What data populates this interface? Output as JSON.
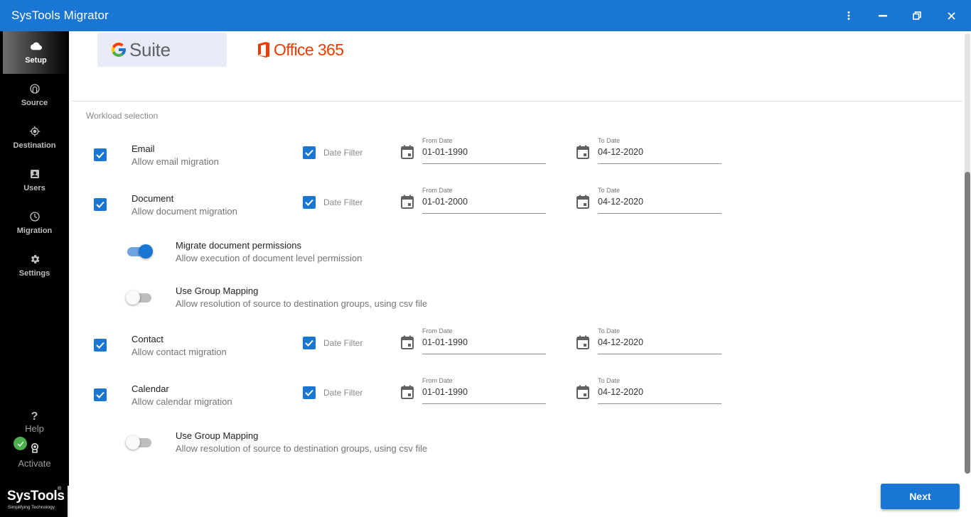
{
  "window": {
    "title": "SysTools Migrator",
    "controls": {
      "menu": "more-vert-icon",
      "minimize": "minimize-icon",
      "restore": "restore-icon",
      "close": "close-icon"
    }
  },
  "sidebar": {
    "items": [
      {
        "label": "Setup",
        "icon": "cloud-icon",
        "active": true
      },
      {
        "label": "Source",
        "icon": "source-icon",
        "active": false
      },
      {
        "label": "Destination",
        "icon": "target-icon",
        "active": false
      },
      {
        "label": "Users",
        "icon": "user-badge-icon",
        "active": false
      },
      {
        "label": "Migration",
        "icon": "clock-icon",
        "active": false
      },
      {
        "label": "Settings",
        "icon": "gear-icon",
        "active": false
      }
    ],
    "help": {
      "label": "Help",
      "icon": "?"
    },
    "activate": {
      "label": "Activate",
      "status_icon": "check-icon"
    },
    "brand": {
      "name": "SysTools",
      "registered": "®",
      "tagline": "Simplifying Technology"
    }
  },
  "providers": {
    "gsuite": {
      "label": "Suite",
      "logo_letter": "G",
      "selected": true
    },
    "office365": {
      "label": "Office 365",
      "selected": false
    }
  },
  "workload": {
    "section_label": "Workload selection",
    "date_filter_label": "Date Filter",
    "from_label": "From Date",
    "to_label": "To Date",
    "items": [
      {
        "title": "Email",
        "subtitle": "Allow email migration",
        "checked": true,
        "date_filter": true,
        "from": "01-01-1990",
        "to": "04-12-2020"
      },
      {
        "title": "Document",
        "subtitle": "Allow document migration",
        "checked": true,
        "date_filter": true,
        "from": "01-01-2000",
        "to": "04-12-2020"
      },
      {
        "title": "Contact",
        "subtitle": "Allow contact migration",
        "checked": true,
        "date_filter": true,
        "from": "01-01-1990",
        "to": "04-12-2020"
      },
      {
        "title": "Calendar",
        "subtitle": "Allow calendar migration",
        "checked": true,
        "date_filter": true,
        "from": "01-01-1990",
        "to": "04-12-2020"
      }
    ],
    "options": [
      {
        "title": "Migrate document permissions",
        "subtitle": "Allow execution of document level permission",
        "on": true
      },
      {
        "title": "Use Group Mapping",
        "subtitle": "Allow resolution of source to destination groups, using csv file",
        "on": false
      },
      {
        "title": "Use Group Mapping",
        "subtitle": "Allow resolution of source to destination groups, using csv file",
        "on": false
      }
    ]
  },
  "footer": {
    "next_label": "Next"
  },
  "colors": {
    "primary": "#1976d2",
    "office": "#eb3c00",
    "success": "#4caf50",
    "sidebar_bg": "#000000"
  }
}
